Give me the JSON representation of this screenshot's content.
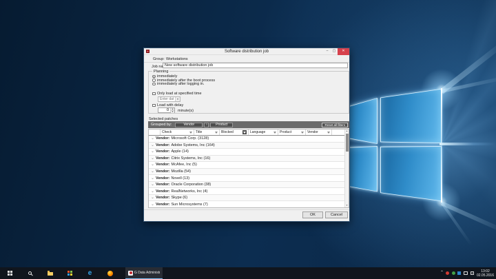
{
  "window": {
    "title": "Software distribution job",
    "controls": {
      "minimize": "–",
      "maximize": "▢",
      "close": "✕"
    },
    "group_label": "Group:",
    "group_value": "Workstations",
    "job_name_label": "Job name:",
    "job_name_value": "New software distribution job",
    "planning": {
      "legend": "Planning",
      "radio_options": [
        "immediately",
        "immediately after the boot process",
        "immediately after logging in."
      ],
      "selected_radio": "immediately",
      "only_load_label": "Only load at specified time",
      "date_placeholder": "Enter date",
      "delay_label": "Load with delay",
      "delay_value": "0",
      "delay_unit": "minute(s)"
    },
    "patches": {
      "section_label": "Selected patches",
      "grouped_by_label": "Grouped by:",
      "group_button_vendor": "Vendor",
      "group_button_product": "Product",
      "reset_button": "Reset all filters",
      "columns": [
        "Check",
        "Title",
        "Blocked",
        "Language",
        "Product",
        "Vendor"
      ],
      "active_filter_column": "Blocked",
      "row_prefix": "Vendor:",
      "rows": [
        "Microsoft Corp. (3128)",
        "Adobe Systems, Inc (164)",
        "Apple (14)",
        "Citrix Systems, Inc (16)",
        "McAfee, Inc (5)",
        "Mozilla (54)",
        "Novell (13)",
        "Oracle Corporation (38)",
        "RealNetworks, Inc (4)",
        "Skype (6)",
        "Sun Microsystems (7)"
      ]
    },
    "ok_label": "OK",
    "cancel_label": "Cancel"
  },
  "taskbar": {
    "app_button_label": "G Data Administrat...",
    "tray_time": "13:02",
    "tray_date": "02.05.2016"
  },
  "icons": {
    "row_expander": "⌄",
    "dropdown_arrow": "▾",
    "spin_up": "▴",
    "spin_down": "▾",
    "group_separator": "›",
    "tray_chevron": "⌃",
    "scroll_up": "▴",
    "scroll_down": "▾",
    "edge_logo": "e"
  },
  "colors": {
    "close_button": "#d6414d",
    "toolbar_background": "#6b6b6b",
    "taskbar_active_accent": "#76b9ed",
    "logo_blue": "#2f8cc9"
  }
}
